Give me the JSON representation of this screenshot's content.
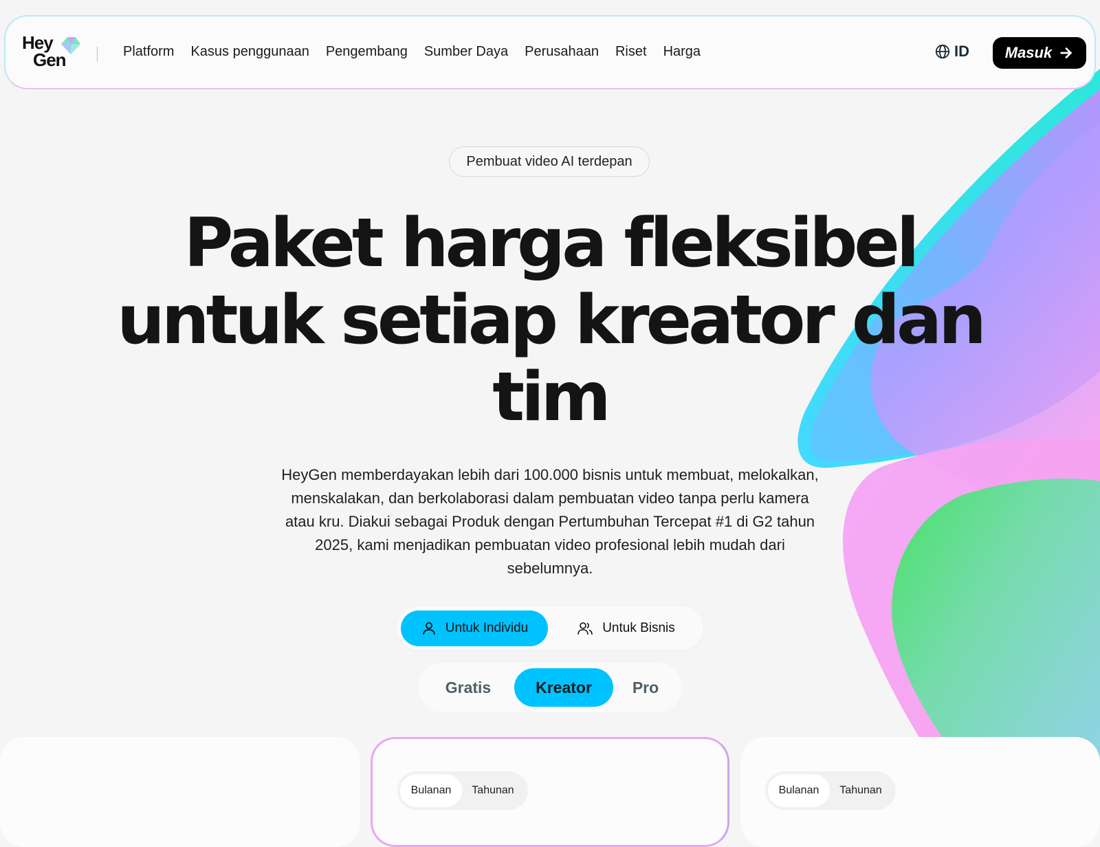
{
  "header": {
    "logo": "HeyGen",
    "menu": [
      "Platform",
      "Kasus penggunaan",
      "Pengembang",
      "Sumber Daya",
      "Perusahaan",
      "Riset",
      "Harga"
    ],
    "language": "ID",
    "language_icon": "globe-icon",
    "login_label": "Masuk",
    "login_icon": "arrow-right-icon"
  },
  "hero": {
    "badge": "Pembuat video AI terdepan",
    "title_lines": [
      "Paket harga fleksibel",
      "untuk setiap kreator dan",
      "tim"
    ],
    "description": "HeyGen memberdayakan lebih dari 100.000 bisnis untuk membuat, melokalkan, menskalakan, dan berkolaborasi dalam pembuatan video tanpa perlu kamera atau kru. Diakui sebagai Produk dengan Pertumbuhan Tercepat #1 di G2 tahun 2025, kami menjadikan pembuatan video profesional lebih mudah dari sebelumnya."
  },
  "audience_toggle": {
    "individual": "Untuk Individu",
    "business": "Untuk Bisnis",
    "selected": "individual"
  },
  "plan_tabs": {
    "items": [
      "Gratis",
      "Kreator",
      "Pro"
    ],
    "selected": "Kreator"
  },
  "cards": {
    "mid_billing": {
      "monthly": "Bulanan",
      "yearly": "Tahunan",
      "selected": "monthly"
    },
    "right_billing": {
      "monthly": "Bulanan",
      "yearly": "Tahunan",
      "selected": "monthly"
    }
  },
  "colors": {
    "accent": "#00c2ff",
    "button_dark": "#000000",
    "background": "#f5f5f5"
  }
}
